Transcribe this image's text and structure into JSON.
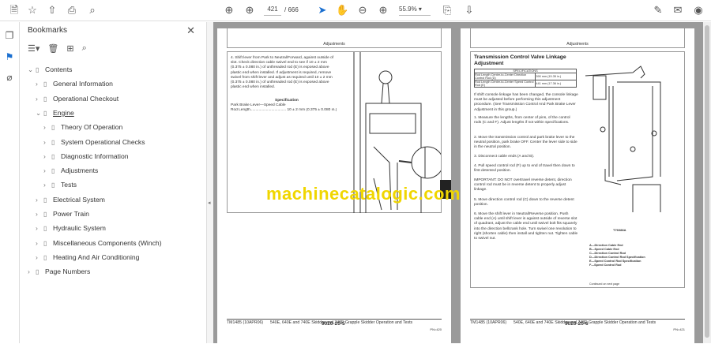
{
  "toolbar": {
    "page_current": "421",
    "page_total": "/ 666",
    "zoom": "55.9%"
  },
  "bookmarks": {
    "title": "Bookmarks",
    "items": [
      {
        "label": "Contents",
        "level": 0
      },
      {
        "label": "General Information",
        "level": 1
      },
      {
        "label": "Operational Checkout",
        "level": 1
      },
      {
        "label": "Engine",
        "level": 1
      },
      {
        "label": "Theory Of Operation",
        "level": 2
      },
      {
        "label": "System Operational Checks",
        "level": 2
      },
      {
        "label": "Diagnostic Information",
        "level": 2
      },
      {
        "label": "Adjustments",
        "level": 2
      },
      {
        "label": "Tests",
        "level": 2
      },
      {
        "label": "Electrical System",
        "level": 1
      },
      {
        "label": "Power Train",
        "level": 1
      },
      {
        "label": "Hydraulic System",
        "level": 1
      },
      {
        "label": "Miscellaneous Components (Winch)",
        "level": 1
      },
      {
        "label": "Heating And Air Conditioning",
        "level": 1
      },
      {
        "label": "Page Numbers",
        "level": 0
      }
    ]
  },
  "left_page": {
    "header": "Adjustments",
    "step4": "4. Shift lever from Park to Neutral/Forward, against outside of slot. Check direction cable swivel end to see if 10 ± 2 mm (0.375 ± 0.080 in.) of unthreaded rod (E) is exposed above plastic end when installed. If adjustment is required, remove swivel from shift lever and adjust as required until 10 ± 2 mm (0.375 ± 0.080 in.) of unthreaded rod (E) is exposed above plastic end when installed.",
    "spec_title": "Specification",
    "spec_line1": "Park Brake Lever—Speed Cable",
    "spec_line2": "Rod Length.................................. 10 ± 2 mm (0.375 ± 0.080 in.)",
    "footer_left": "TM1485 (10APR06)",
    "footer_mid": "540E, 640E and 740E Skidder and 748E Grapple Skidder Operation and Tests",
    "footer_code": "9020-20-5",
    "footer_right": "PN=420"
  },
  "right_page": {
    "header": "Adjustments",
    "title": "Transmission Control Valve Linkage Adjustment",
    "spec_header": "SPECIFICATIONS",
    "spec_rows": [
      [
        "Rod Length Center-to-Center Direction Control Rod (D)",
        "390 mm (15.35 in.)"
      ],
      [
        "Rod Length Center-to-Center Speed Control Rod (E)",
        "441 mm (17.36 in.)"
      ]
    ],
    "intro": "If shift console linkage has been changed, the console linkage must be adjusted before performing this adjustment procedure. (See Transmission Control And Park Brake Lever Adjustment in this group.)",
    "steps": [
      "1. Measure the lengths, from center of pins, of the control rods (C and F). Adjust lengths if not within specifications.",
      "2. Move the transmission control and park brake lever to the neutral position, park brake OFF. Center the lever side to side in the neutral position.",
      "3. Disconnect cable ends (A and B).",
      "4. Pull speed control rod (F) up to end of travel then down to first detented position.",
      "IMPORTANT: DO NOT overtravel reverse detent, direction control rod must be in reverse detent to properly adjust linkage.",
      "5. Move direction control rod (C) down to the reverse detent position.",
      "6. Move the shift lever in Neutral/Reverse position. Push cable end (A) until shift lever is against outside of reverse slot of quadrant, adjust the cable end until swivel bolt fits squarely into the direction bellcrank hole. Turn swivel one revolution to right (shorten cable) then install and tighten nut. Tighten cable to swivel nut."
    ],
    "fig_label": "T76088A",
    "legend": [
      "A—Direction Cable End",
      "B—Speed Cable End",
      "C—Direction Control Rod",
      "D—Direction Control Rod Specification",
      "E—Speed Control Rod Specification",
      "F—Speed Control Rod"
    ],
    "continued": "Continued on next page",
    "footer_left": "TM1485 (10APR06)",
    "footer_mid": "540E, 640E and 740E Skidder and 748E Grapple Skidder Operation and Tests",
    "footer_code": "9020-20-6",
    "footer_right": "PN=421"
  },
  "watermark": "machinecatalogic.com"
}
